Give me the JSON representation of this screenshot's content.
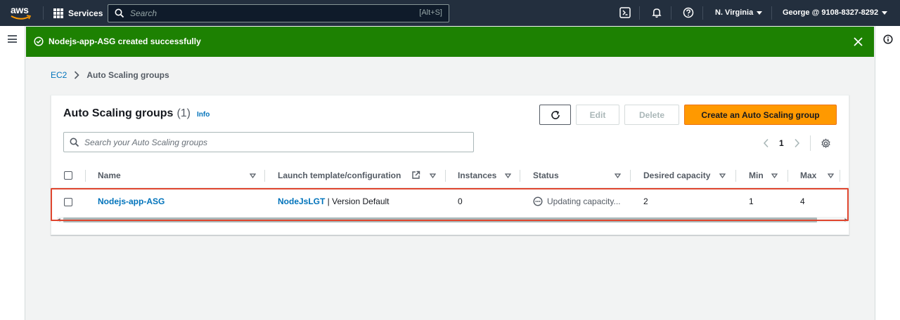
{
  "topnav": {
    "logo_text": "aws",
    "services_label": "Services",
    "search_placeholder": "Search",
    "search_shortcut": "[Alt+S]",
    "region": "N. Virginia",
    "account": "George @ 9108-8327-8292",
    "background": "#232f3e"
  },
  "flash": {
    "message": "Nodejs-app-ASG created successfully",
    "color": "#1d8102"
  },
  "breadcrumb": {
    "items": [
      "EC2",
      "Auto Scaling groups"
    ]
  },
  "panel": {
    "title": "Auto Scaling groups",
    "count": "(1)",
    "info_label": "Info",
    "buttons": {
      "edit": "Edit",
      "delete": "Delete",
      "create": "Create an Auto Scaling group"
    },
    "filter_placeholder": "Search your Auto Scaling groups",
    "page_number": "1",
    "accent": "#ff9900"
  },
  "table": {
    "columns": [
      "Name",
      "Launch template/configuration",
      "Instances",
      "Status",
      "Desired capacity",
      "Min",
      "Max"
    ],
    "rows": [
      {
        "name": "Nodejs-app-ASG",
        "template_link": "NodeJsLGT",
        "template_version": " | Version Default",
        "instances": "0",
        "status": "Updating capacity...",
        "desired": "2",
        "min": "1",
        "max": "4"
      }
    ]
  }
}
